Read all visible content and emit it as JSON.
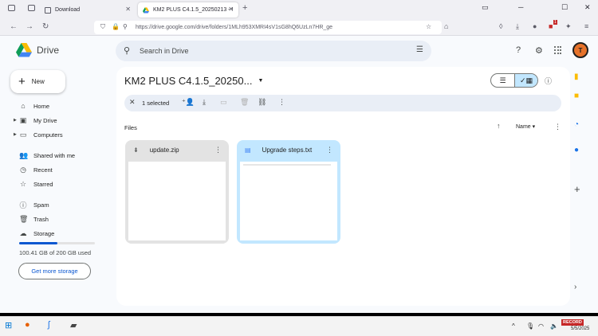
{
  "browser": {
    "tabs": [
      {
        "label": "Download"
      },
      {
        "label": "KM2 PLUS C4.1.5_20250213 - G"
      }
    ],
    "url": "https://drive.google.com/drive/folders/1MLh953XMRI4sV1sG8hQ6UzLn7HR_ge",
    "badge_count": "1"
  },
  "drive": {
    "product_name": "Drive",
    "search_placeholder": "Search in Drive",
    "avatar_initial": "T",
    "new_label": "New",
    "nav": [
      {
        "label": "Home",
        "icon": "home-icon"
      },
      {
        "label": "My Drive",
        "icon": "my-drive-icon"
      },
      {
        "label": "Computers",
        "icon": "computers-icon"
      },
      {
        "label": "Shared with me",
        "icon": "shared-icon"
      },
      {
        "label": "Recent",
        "icon": "clock-icon"
      },
      {
        "label": "Starred",
        "icon": "star-icon"
      },
      {
        "label": "Spam",
        "icon": "spam-icon"
      },
      {
        "label": "Trash",
        "icon": "trash-icon"
      },
      {
        "label": "Storage",
        "icon": "cloud-icon"
      }
    ],
    "storage": {
      "used_text": "100.41 GB of 200 GB used",
      "fraction": 0.5,
      "button": "Get more storage"
    },
    "folder_title": "KM2 PLUS C4.1.5_20250...",
    "selection": {
      "text": "1 selected"
    },
    "section_label": "Files",
    "sort_label": "Name",
    "files": [
      {
        "name": "update.zip",
        "icon": "zip-icon",
        "selected": false
      },
      {
        "name": "Upgrade steps.txt",
        "icon": "doc-icon",
        "selected": true
      }
    ]
  },
  "taskbar": {
    "rec_label": "RECORD",
    "date": "5/5/2025"
  },
  "colors": {
    "accent": "#0b57d0",
    "selected_card": "#c2e7ff",
    "page_bg": "#f8fafd"
  }
}
